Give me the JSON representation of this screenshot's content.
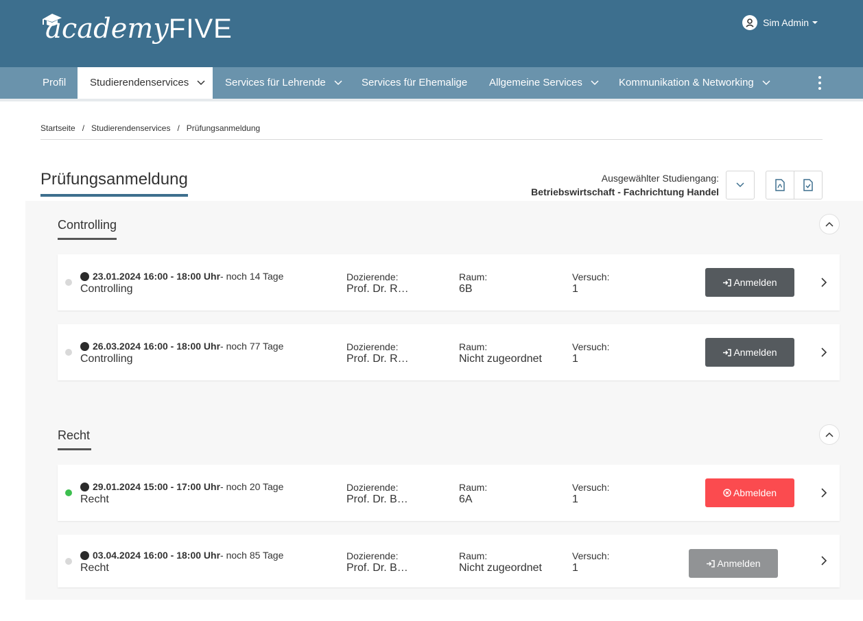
{
  "header": {
    "logo_text_lower": "academy",
    "logo_text_upper": "FIVE",
    "user_name": "Sim Admin"
  },
  "nav": {
    "items": [
      {
        "label": "Profil",
        "active": false,
        "dropdown": false
      },
      {
        "label": "Studierendenservices",
        "active": true,
        "dropdown": true
      },
      {
        "label": "Services für Lehrende",
        "active": false,
        "dropdown": true
      },
      {
        "label": "Services für Ehemalige",
        "active": false,
        "dropdown": false
      },
      {
        "label": "Allgemeine Services",
        "active": false,
        "dropdown": true
      },
      {
        "label": "Kommunikation & Networking",
        "active": false,
        "dropdown": true
      }
    ]
  },
  "breadcrumb": [
    "Startseite",
    "Studierendenservices",
    "Prüfungsanmeldung"
  ],
  "breadcrumb_separator": "/",
  "page": {
    "title": "Prüfungsanmeldung",
    "studiengang_label": "Ausgewählter Studiengang:",
    "studiengang_value": "Betriebswirtschaft - Fachrichtung Handel"
  },
  "labels": {
    "dozierende": "Dozierende:",
    "raum": "Raum:",
    "versuch": "Versuch:"
  },
  "sections": [
    {
      "title": "Controlling",
      "exams": [
        {
          "datetime": "23.01.2024 16:00 - 18:00 Uhr",
          "remaining": " - noch 14 Tage",
          "course": "Controlling",
          "dozierende": "Prof. Dr. R…",
          "raum": "6B",
          "versuch": "1",
          "action": "Anmelden",
          "action_style": "dark",
          "registered": false
        },
        {
          "datetime": "26.03.2024 16:00 - 18:00 Uhr",
          "remaining": " - noch 77 Tage",
          "course": "Controlling",
          "dozierende": "Prof. Dr. R…",
          "raum": "Nicht zugeordnet",
          "versuch": "1",
          "action": "Anmelden",
          "action_style": "dark",
          "registered": false
        }
      ]
    },
    {
      "title": "Recht",
      "exams": [
        {
          "datetime": "29.01.2024 15:00 - 17:00 Uhr",
          "remaining": " - noch 20 Tage",
          "course": "Recht",
          "dozierende": "Prof. Dr. B…",
          "raum": "6A",
          "versuch": "1",
          "action": "Abmelden",
          "action_style": "red",
          "registered": true
        },
        {
          "datetime": "03.04.2024 16:00 - 18:00 Uhr",
          "remaining": " - noch 85 Tage",
          "course": "Recht",
          "dozierende": "Prof. Dr. B…",
          "raum": "Nicht zugeordnet",
          "versuch": "1",
          "action": "Anmelden",
          "action_style": "grey",
          "registered": false
        }
      ]
    }
  ],
  "colors": {
    "header": "#3d6f8e",
    "nav": "#6a93ac",
    "btn_dark": "#555a5e",
    "btn_red": "#fb4b4f",
    "btn_grey": "#919395",
    "status_green": "#3dbf4f"
  }
}
